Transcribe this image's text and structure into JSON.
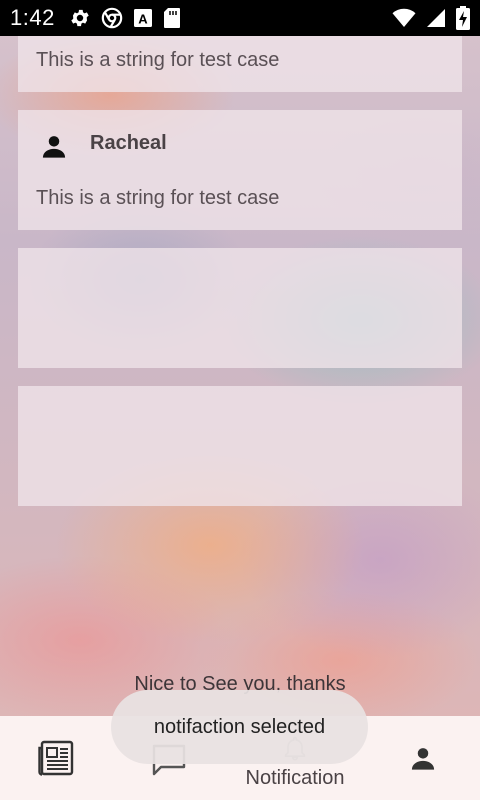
{
  "status_bar": {
    "time": "1:42",
    "left_icons": [
      "gear-icon",
      "chrome-icon",
      "font-a-icon",
      "sd-card-icon"
    ],
    "right_icons": [
      "wifi-icon",
      "signal-icon",
      "battery-charging-icon"
    ]
  },
  "cards": [
    {
      "name": "",
      "text": "This is a string for test case"
    },
    {
      "name": "Racheal",
      "text": "This is a string for test case",
      "avatar_icon": "person-icon"
    },
    {
      "name": "",
      "text": ""
    },
    {
      "name": "",
      "text": ""
    }
  ],
  "footer_text": "Nice to See you, thanks",
  "bottom_nav": {
    "items": [
      {
        "icon": "newspaper-icon",
        "label": ""
      },
      {
        "icon": "chat-icon",
        "label": ""
      },
      {
        "icon": "bell-icon",
        "label": "Notification"
      },
      {
        "icon": "person-icon",
        "label": ""
      }
    ]
  },
  "toast": {
    "text": "notifaction selected"
  },
  "colors": {
    "status_bar": "#000000",
    "nav_background": "#fbf2f1",
    "card_background": "#f0e4e9",
    "toast_background": "#e8e2e2"
  }
}
